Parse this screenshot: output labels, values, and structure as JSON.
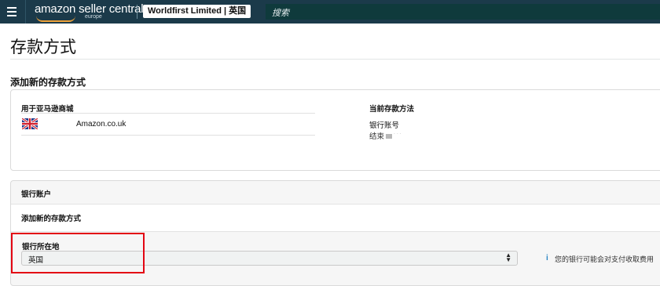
{
  "header": {
    "logo_text": "amazon seller central",
    "logo_region": "europe",
    "store_selector": "Worldfirst Limited | 英国",
    "search_placeholder": "搜索",
    "colors": {
      "bar": "#1b3a4a",
      "search": "#0f3a3c",
      "logo_smile": "#f0a33a"
    }
  },
  "page": {
    "title": "存款方式",
    "section_heading": "添加新的存款方式"
  },
  "summary": {
    "marketplace_heading": "用于亚马逊商城",
    "marketplace_name": "Amazon.co.uk",
    "marketplace_flag": "uk-flag-icon",
    "current_method_heading": "当前存款方法",
    "bank_account_label": "银行账号",
    "account_ending_label": "结束"
  },
  "bank_account": {
    "panel_title": "银行账户",
    "subheading": "添加新的存款方式",
    "location_label": "银行所在地",
    "location_value": "英国",
    "info_icon": "i",
    "info_text": "您的银行可能会对支付收取费用",
    "highlight_color": "#e30613"
  }
}
